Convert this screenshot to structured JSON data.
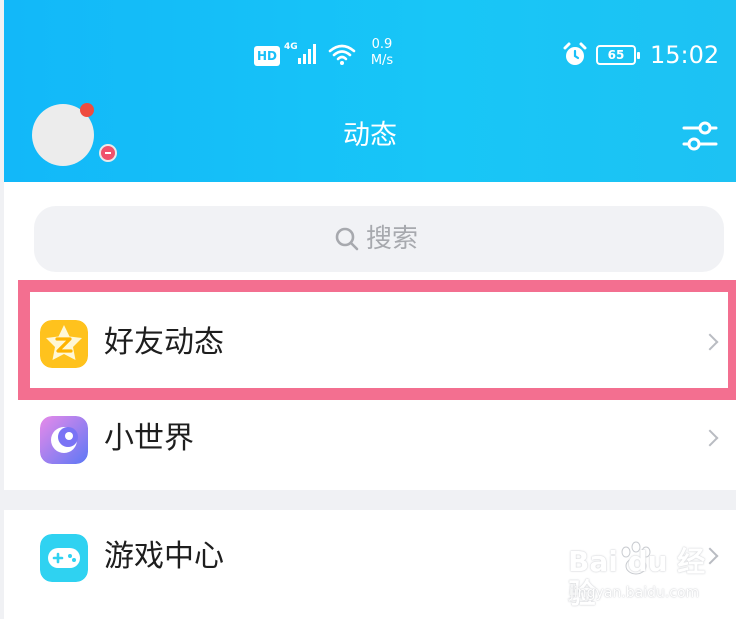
{
  "status_bar": {
    "hd": "HD",
    "network_type": "4G",
    "network_speed_value": "0.9",
    "network_speed_unit": "M/s",
    "battery_level": "65",
    "time": "15:02"
  },
  "header": {
    "title": "动态"
  },
  "search": {
    "placeholder": "搜索"
  },
  "items": [
    {
      "label": "好友动态",
      "icon": "star-z-icon",
      "icon_color": "#ffc21d"
    },
    {
      "label": "小世界",
      "icon": "crescent-planet-icon",
      "icon_color": "#7a73f5"
    },
    {
      "label": "游戏中心",
      "icon": "gamepad-icon",
      "icon_color": "#2fd2f1"
    }
  ],
  "colors": {
    "header_gradient_start": "#12b8f9",
    "header_gradient_end": "#1dc2f3",
    "highlight": "#f36f90",
    "badge_red": "#ee4c3f"
  },
  "watermark": {
    "brand": "Bai du 经验",
    "site": "jingyan.baidu.com"
  }
}
